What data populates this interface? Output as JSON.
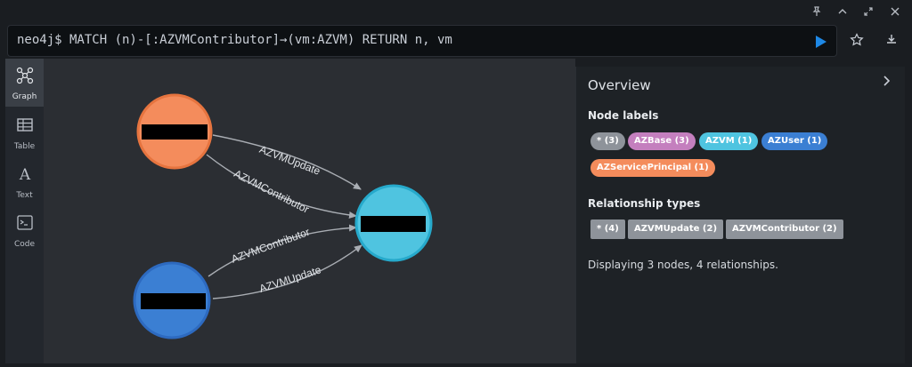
{
  "editor": {
    "prompt": "neo4j$ MATCH (n)-[:AZVMContributor]→(vm:AZVM) RETURN n, vm"
  },
  "window_buttons": [
    "pin-icon",
    "minimize-icon",
    "fullscreen-icon",
    "close-icon"
  ],
  "toolbar": [
    "run-icon",
    "star-icon",
    "download-icon"
  ],
  "nav": [
    {
      "label": "Graph",
      "icon": "graph-icon",
      "active": true
    },
    {
      "label": "Table",
      "icon": "table-icon",
      "active": false
    },
    {
      "label": "Text",
      "icon": "text-icon",
      "active": false
    },
    {
      "label": "Code",
      "icon": "code-icon",
      "active": false
    }
  ],
  "graph": {
    "nodes": [
      {
        "id": "n1",
        "color": "#f48c5c",
        "border": "#e6743f",
        "redacted": true
      },
      {
        "id": "n2",
        "color": "#3b7fd3",
        "border": "#2d6ac0",
        "redacted": true
      },
      {
        "id": "vm",
        "color": "#4fc4e0",
        "border": "#26a9cb",
        "redacted": true
      }
    ],
    "edges": [
      {
        "label": "AZVMUpdate"
      },
      {
        "label": "AZVMContributor"
      },
      {
        "label": "AZVMContributor"
      },
      {
        "label": "AZVMUpdate"
      }
    ]
  },
  "overview": {
    "title": "Overview",
    "node_labels_heading": "Node labels",
    "node_labels": [
      {
        "text": "* (3)",
        "color": "#8e939a"
      },
      {
        "text": "AZBase (3)",
        "color": "#c47fbe"
      },
      {
        "text": "AZVM (1)",
        "color": "#4fc4e0"
      },
      {
        "text": "AZUser (1)",
        "color": "#3b7fd3"
      },
      {
        "text": "AZServicePrincipal (1)",
        "color": "#f48c5c"
      }
    ],
    "relationship_heading": "Relationship types",
    "relationship_types": [
      {
        "text": "* (4)"
      },
      {
        "text": "AZVMUpdate (2)"
      },
      {
        "text": "AZVMContributor (2)"
      }
    ],
    "summary": "Displaying 3 nodes, 4 relationships."
  }
}
